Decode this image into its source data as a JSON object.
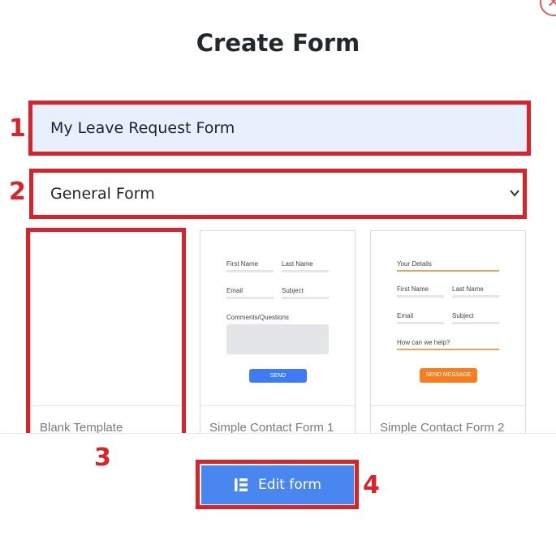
{
  "dialog": {
    "title": "Create Form",
    "close_symbol": "✕"
  },
  "form_name": {
    "value": "My Leave Request Form"
  },
  "form_type": {
    "selected": "General Form"
  },
  "templates": [
    {
      "label": "Blank Template"
    },
    {
      "label": "Simple Contact Form 1",
      "preview": {
        "first_name": "First Name",
        "last_name": "Last Name",
        "email": "Email",
        "subject": "Subject",
        "comments": "Comments/Questions",
        "button": "SEND",
        "button_color": "#3f7cf3"
      }
    },
    {
      "label": "Simple Contact Form 2",
      "preview": {
        "section": "Your Details",
        "first_name": "First Name",
        "last_name": "Last Name",
        "email": "Email",
        "subject": "Subject",
        "help": "How can we help?",
        "button": "SEND MESSAGE",
        "button_color": "#f57f20"
      }
    }
  ],
  "footer": {
    "edit_button": "Edit form",
    "edit_icon": "elementor-icon"
  },
  "annotations": [
    "1",
    "2",
    "3",
    "4"
  ],
  "colors": {
    "highlight": "#d9232a",
    "primary": "#4a86f0",
    "input_bg": "#e8f0fe"
  }
}
